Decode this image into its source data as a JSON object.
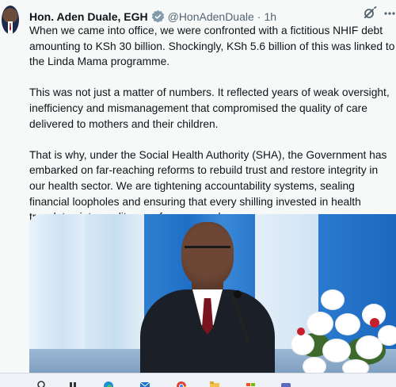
{
  "tweet": {
    "author_name": "Hon. Aden Duale, EGH",
    "handle": "@HonAdenDuale",
    "separator": "·",
    "time": "1h",
    "verified_badge_icon": "government-verified-badge-icon",
    "paragraphs": [
      "When we came into office, we were confronted with a fictitious NHIF debt amounting to KSh 30 billion. Shockingly, KSh 5.6 billion of this was linked to the Linda Mama programme.",
      "This was not just a matter of numbers. It reflected years of weak oversight, inefficiency and mismanagement that compromised the quality of care delivered to mothers and their children.",
      "That is why, under the Social Health Authority (SHA), the Government has embarked on far-reaching reforms to rebuild trust and restore integrity in our health sector. We are tightening accountability systems, sealing financial loopholes and ensuring that every shilling invested in health translates into quality care for our people."
    ]
  },
  "colors": {
    "background": "#f7f9f9",
    "text_primary": "#0f1419",
    "text_secondary": "#536471",
    "verified_badge": "#829aab"
  },
  "taskbar": {
    "icons": [
      "search-icon",
      "file-explorer-icon",
      "edge-browser-icon",
      "mail-icon",
      "chrome-icon",
      "folder-icon",
      "store-icon",
      "app-icon"
    ]
  }
}
